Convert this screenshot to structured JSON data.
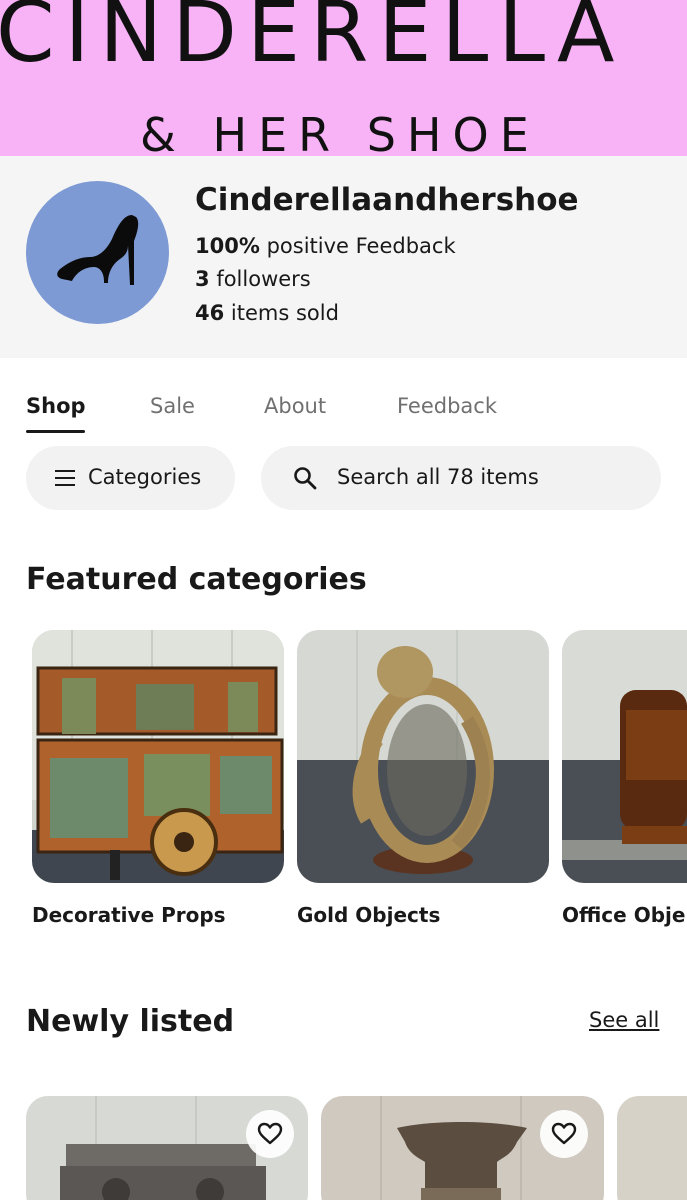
{
  "banner": {
    "line1": "CINDERELLA",
    "line2": "& HER SHOE",
    "bg_color": "#f7b3f5"
  },
  "profile": {
    "store_name": "Cinderellaandhershoe",
    "feedback_value": "100%",
    "feedback_label": "positive Feedback",
    "followers_value": "3",
    "followers_label": "followers",
    "sold_value": "46",
    "sold_label": "items sold",
    "avatar_icon": "high-heel-shoe-icon",
    "avatar_color": "#7e9ad4"
  },
  "tabs": [
    {
      "label": "Shop",
      "active": true
    },
    {
      "label": "Sale",
      "active": false
    },
    {
      "label": "About",
      "active": false
    },
    {
      "label": "Feedback",
      "active": false
    }
  ],
  "controls": {
    "categories_label": "Categories",
    "categories_icon": "menu-icon",
    "search_label": "Search all 78 items",
    "search_icon": "search-icon"
  },
  "featured": {
    "title": "Featured categories",
    "items": [
      {
        "label": "Decorative Props"
      },
      {
        "label": "Gold Objects"
      },
      {
        "label": "Office Obje"
      }
    ]
  },
  "newly_listed": {
    "title": "Newly listed",
    "see_all_label": "See all",
    "fav_icon": "heart-icon"
  }
}
